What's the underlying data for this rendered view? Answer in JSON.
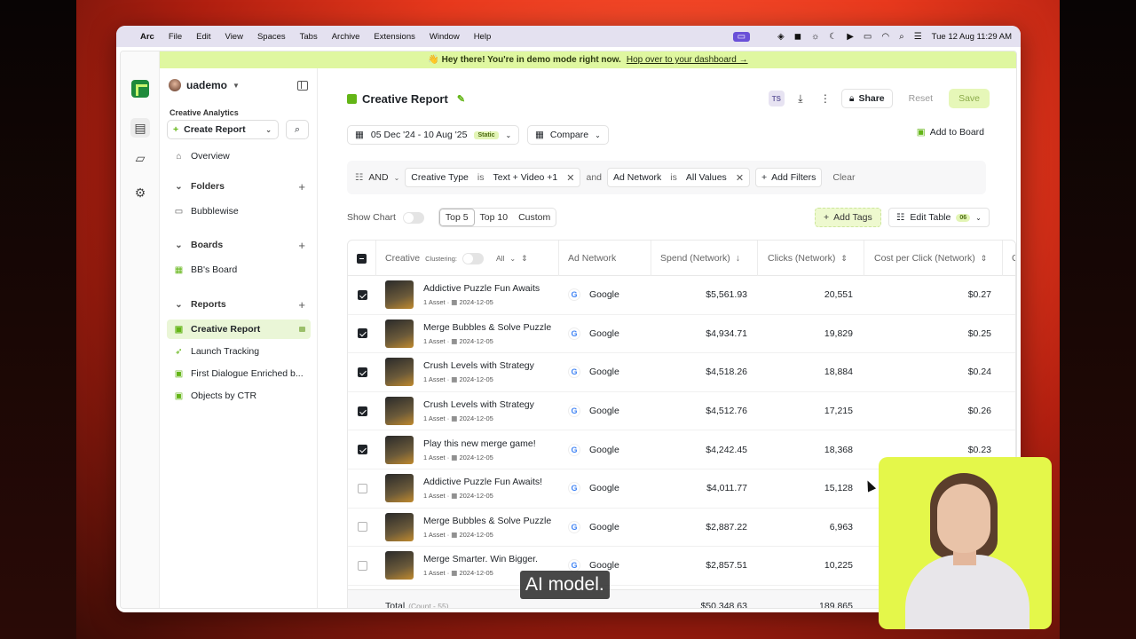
{
  "menubar": {
    "app": "Arc",
    "items": [
      "File",
      "Edit",
      "View",
      "Spaces",
      "Tabs",
      "Archive",
      "Extensions",
      "Window",
      "Help"
    ],
    "clock": "Tue 12 Aug  11:29 AM"
  },
  "banner": {
    "text": "👋 Hey there! You're in demo mode right now.",
    "link": "Hop over to your dashboard →"
  },
  "sidebar": {
    "user": "uademo",
    "section": "Creative Analytics",
    "create": "Create Report",
    "overview": "Overview",
    "folders": "Folders",
    "folder_items": [
      "Bubblewise"
    ],
    "boards": "Boards",
    "board_items": [
      "BB's Board"
    ],
    "reports": "Reports",
    "report_items": [
      "Creative Report",
      "Launch Tracking",
      "First Dialogue Enriched b...",
      "Objects by CTR"
    ]
  },
  "header": {
    "title": "Creative Report",
    "ts": "TS",
    "share": "Share",
    "reset": "Reset",
    "save": "Save"
  },
  "date": {
    "range": "05 Dec '24 - 10 Aug '25",
    "badge": "Static",
    "compare": "Compare",
    "add_board": "Add to Board"
  },
  "filters": {
    "logic": "AND",
    "f1_field": "Creative Type",
    "f1_op": "is",
    "f1_value": "Text + Video  +1",
    "joiner": "and",
    "f2_field": "Ad Network",
    "f2_op": "is",
    "f2_value": "All Values",
    "add": "Add Filters",
    "clear": "Clear"
  },
  "toolbar": {
    "show_chart": "Show Chart",
    "top5": "Top 5",
    "top10": "Top 10",
    "custom": "Custom",
    "add_tags": "Add Tags",
    "edit_table": "Edit Table",
    "edit_count": "06"
  },
  "table": {
    "headers": {
      "creative": "Creative",
      "clustering": "Clustering:",
      "all": "All",
      "network": "Ad Network",
      "spend": "Spend (Network)",
      "clicks": "Clicks (Network)",
      "cpc": "Cost per Click (Network)",
      "extra": "C"
    },
    "rows": [
      {
        "name": "Addictive Puzzle Fun Awaits",
        "assets": "1 Asset",
        "date": "2024-12-05",
        "network": "Google",
        "spend": "$5,561.93",
        "clicks": "20,551",
        "cpc": "$0.27",
        "checked": true
      },
      {
        "name": "Merge Bubbles & Solve Puzzle",
        "assets": "1 Asset",
        "date": "2024-12-05",
        "network": "Google",
        "spend": "$4,934.71",
        "clicks": "19,829",
        "cpc": "$0.25",
        "checked": true
      },
      {
        "name": "Crush Levels with Strategy",
        "assets": "1 Asset",
        "date": "2024-12-05",
        "network": "Google",
        "spend": "$4,518.26",
        "clicks": "18,884",
        "cpc": "$0.24",
        "checked": true
      },
      {
        "name": "Crush Levels with Strategy",
        "assets": "1 Asset",
        "date": "2024-12-05",
        "network": "Google",
        "spend": "$4,512.76",
        "clicks": "17,215",
        "cpc": "$0.26",
        "checked": true
      },
      {
        "name": "Play this new merge game!",
        "assets": "1 Asset",
        "date": "2024-12-05",
        "network": "Google",
        "spend": "$4,242.45",
        "clicks": "18,368",
        "cpc": "$0.23",
        "checked": true
      },
      {
        "name": "Addictive Puzzle Fun Awaits!",
        "assets": "1 Asset",
        "date": "2024-12-05",
        "network": "Google",
        "spend": "$4,011.77",
        "clicks": "15,128",
        "cpc": "",
        "checked": false
      },
      {
        "name": "Merge Bubbles & Solve Puzzle",
        "assets": "1 Asset",
        "date": "2024-12-05",
        "network": "Google",
        "spend": "$2,887.22",
        "clicks": "6,963",
        "cpc": "",
        "checked": false
      },
      {
        "name": "Merge Smarter. Win Bigger.",
        "assets": "1 Asset",
        "date": "2024-12-05",
        "network": "Google",
        "spend": "$2,857.51",
        "clicks": "10,225",
        "cpc": "",
        "checked": false
      }
    ],
    "total_label": "Total",
    "total_count": "(Count - 55)",
    "total_spend": "$50,348.63",
    "total_clicks": "189,865"
  },
  "caption": "AI model."
}
